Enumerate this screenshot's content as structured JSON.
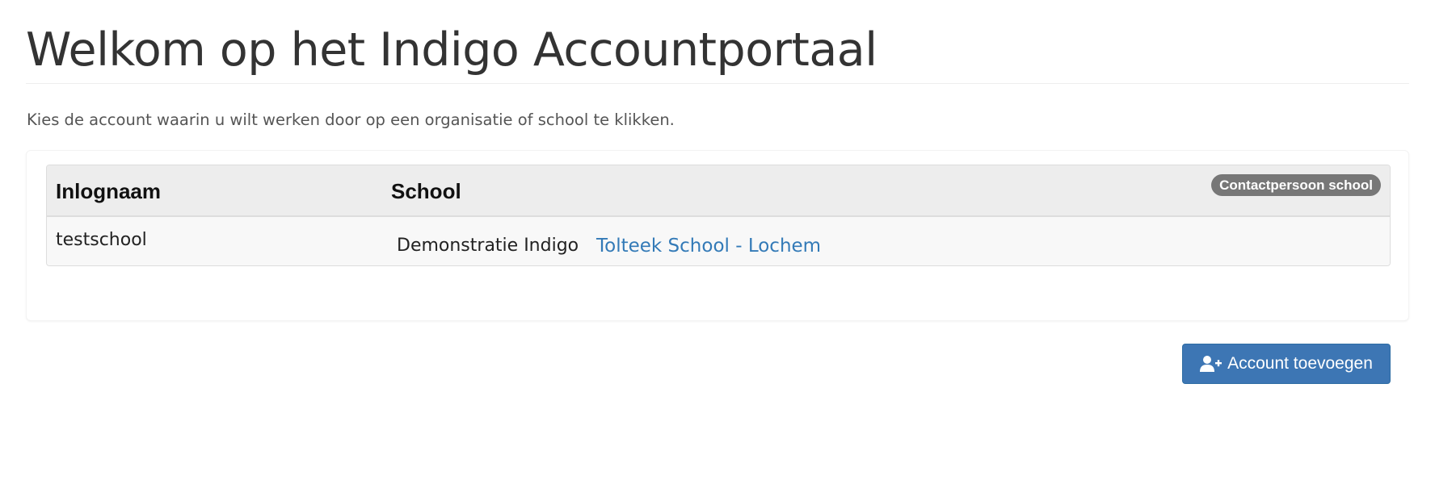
{
  "page": {
    "title": "Welkom op het Indigo Accountportaal",
    "intro": "Kies de account waarin u wilt werken door op een organisatie of school te klikken."
  },
  "table": {
    "headers": {
      "login": "Inlognaam",
      "school": "School",
      "badge": "Contactpersoon school"
    },
    "rows": [
      {
        "login": "testschool",
        "school": "Demonstratie Indigo",
        "link": "Tolteek School - Lochem"
      }
    ]
  },
  "actions": {
    "add_account_label": "Account toevoegen",
    "add_account_icon": "user-plus-icon"
  },
  "colors": {
    "link": "#337ab7",
    "primary_button": "#3d76b4",
    "badge": "#777777"
  }
}
